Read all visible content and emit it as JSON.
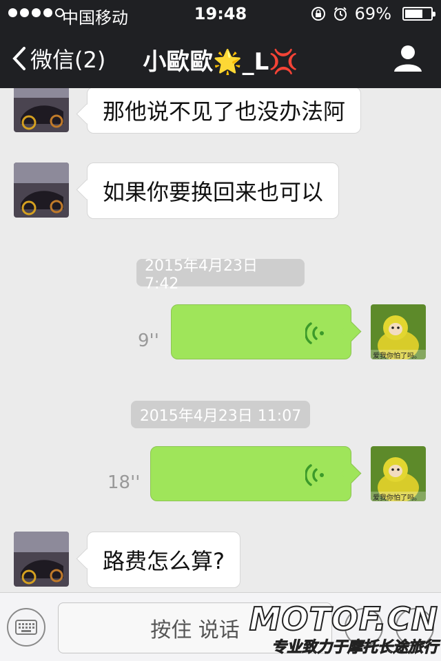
{
  "status": {
    "carrier": "中国移动",
    "time": "19:48",
    "battery_text": "69%",
    "battery_level": 0.69
  },
  "nav": {
    "back_label": "微信(2)",
    "title": "小歐歐🌟_L💢"
  },
  "messages": {
    "m1": {
      "text": "那他说不见了也没办法阿"
    },
    "m2": {
      "text": "如果你要换回来也可以"
    },
    "ts1": "2015年4月23日 7:42",
    "v1": {
      "duration": "9''"
    },
    "ts2": "2015年4月23日 11:07",
    "v2": {
      "duration": "18''"
    },
    "m3": {
      "text": "路费怎么算?"
    }
  },
  "sticker_caption": "爱我你怕了吗。",
  "input": {
    "hold_to_talk": "按住 说话"
  },
  "watermark": {
    "logo": "MOTOF.CN",
    "slogan": "专业致力于摩托长途旅行"
  },
  "colors": {
    "nav_bg": "#1f2023",
    "chat_bg": "#ebebeb",
    "voice_bubble": "#9fe55a",
    "timestamp_bg": "#cecece"
  }
}
